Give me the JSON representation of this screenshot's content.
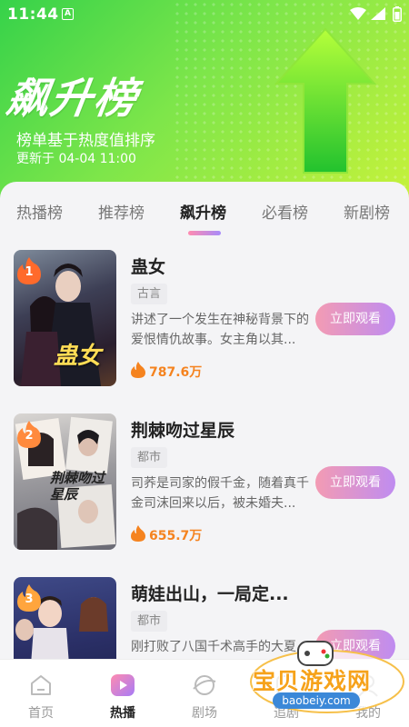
{
  "status_bar": {
    "time": "11:44",
    "app_icon_letter": "A"
  },
  "hero": {
    "title": "飙升榜",
    "subtitle": "榜单基于热度值排序",
    "updated": "更新于 04-04 11:00"
  },
  "tabs": [
    {
      "label": "热播榜",
      "active": false
    },
    {
      "label": "推荐榜",
      "active": false
    },
    {
      "label": "飙升榜",
      "active": true
    },
    {
      "label": "必看榜",
      "active": false
    },
    {
      "label": "新剧榜",
      "active": false
    }
  ],
  "dramas": [
    {
      "rank": "1",
      "title": "蛊女",
      "poster_text": "蛊女",
      "genre": "古言",
      "description": "讲述了一个发生在神秘背景下的爱恨情仇故事。女主角以其...",
      "heat": "787.6万",
      "button": "立即观看"
    },
    {
      "rank": "2",
      "title": "荆棘吻过星辰",
      "poster_text": "荆棘吻过星辰",
      "genre": "都市",
      "description": "司荞是司家的假千金，随着真千金司沫回来以后，被未婚夫...",
      "heat": "655.7万",
      "button": "立即观看"
    },
    {
      "rank": "3",
      "title": "萌娃出山，一局定...",
      "poster_text": "",
      "genre": "都市",
      "description": "刚打败了八国千术高手的大夏",
      "heat": "",
      "button": "立即观看"
    }
  ],
  "bottom_nav": [
    {
      "label": "首页",
      "active": false,
      "icon": "home-icon"
    },
    {
      "label": "热播",
      "active": true,
      "icon": "play-icon"
    },
    {
      "label": "剧场",
      "active": false,
      "icon": "theater-icon"
    },
    {
      "label": "追剧",
      "active": false,
      "icon": "follow-icon"
    },
    {
      "label": "我的",
      "active": false,
      "icon": "profile-icon"
    }
  ],
  "watermark": {
    "text": "宝贝游戏网",
    "url": "baobeiy.com"
  },
  "colors": {
    "hero_green": "#36d24a",
    "hero_lime": "#c8f23a",
    "heat_orange": "#f5831f",
    "button_pink": "#f39bb3",
    "button_purple": "#bf8cf0",
    "rank_badge": "#ff6a2b"
  }
}
